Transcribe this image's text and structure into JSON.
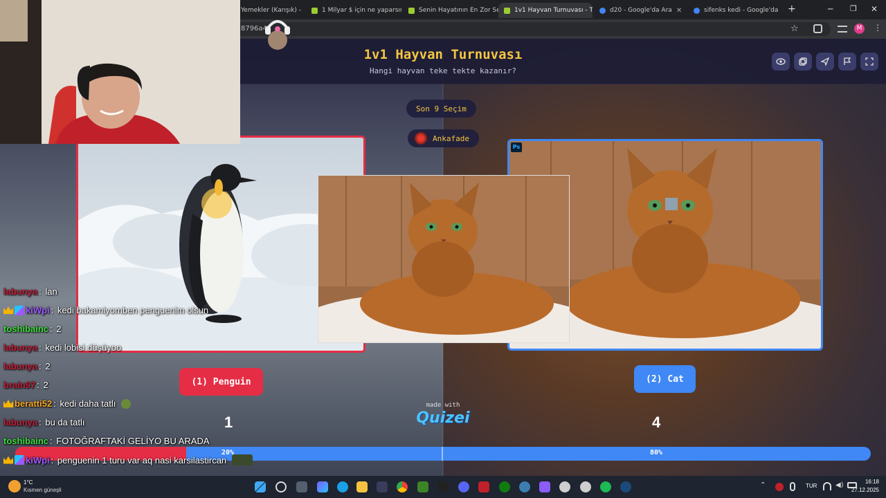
{
  "browser": {
    "tabs": [
      {
        "title": "Yemekler (Karışık) -",
        "color": "#e8a033"
      },
      {
        "title": "1 Milyar $ için ne yaparsın",
        "color": "#9acd32"
      },
      {
        "title": "Senin Hayatının En Zor Se",
        "color": "#9acd32"
      },
      {
        "title": "1v1 Hayvan Turnuvası - T",
        "color": "#9acd32"
      },
      {
        "title": "d20 - Google'da Ara",
        "color": "#4285f4"
      },
      {
        "title": "sifenks kedi - Google'da",
        "color": "#4285f4"
      }
    ],
    "url_fragment": "8796a4",
    "profile_initial": "M"
  },
  "quiz": {
    "title": "1v1 Hayvan Turnuvası",
    "subtitle": "Hangi hayvan teke tekte kazanır?",
    "round_label": "Son 9 Seçim",
    "author": "Ankafade",
    "header_icons": [
      "eye-icon",
      "copy-icon",
      "send-icon",
      "flag-icon",
      "fullscreen-icon"
    ],
    "left": {
      "button": "(1) Penguin",
      "score": "1",
      "percent": "20%",
      "color": "#e52d45",
      "fraction": 0.2
    },
    "right": {
      "button": "(2) Cat",
      "score": "4",
      "percent": "80%",
      "color": "#3f88f5"
    },
    "made_with": "made with",
    "brand": "Quizei",
    "ps_badge": "Ps"
  },
  "chat": [
    {
      "user": "labunya",
      "color": "#c0203a",
      "msg": "lan",
      "badges": []
    },
    {
      "user": "kiWpi",
      "color": "#9b59ff",
      "msg": "kedi bakamiyomben penguenim olsun",
      "badges": [
        "crown",
        "square"
      ]
    },
    {
      "user": "toshibainc",
      "color": "#3ddc3d",
      "msg": "2",
      "badges": []
    },
    {
      "user": "labunya",
      "color": "#c0203a",
      "msg": "kedi lobisi düşüyoo",
      "badges": []
    },
    {
      "user": "labunya",
      "color": "#c0203a",
      "msg": "2",
      "badges": []
    },
    {
      "user": "brain97",
      "color": "#c0203a",
      "msg": "2",
      "badges": []
    },
    {
      "user": "beratti52",
      "color": "#f5a623",
      "msg": "kedi daha tatlı",
      "badges": [
        "crown"
      ]
    },
    {
      "user": "labunya",
      "color": "#c0203a",
      "msg": "bu da tatlı",
      "badges": []
    },
    {
      "user": "toshibainc",
      "color": "#3ddc3d",
      "msg": "FOTOĞRAFTAKİ GELİYO BU ARADA",
      "badges": []
    },
    {
      "user": "kiWpi",
      "color": "#9b59ff",
      "msg": "penguenin 1 turu var aq nasi karsilastircan",
      "badges": [
        "crown",
        "square"
      ]
    }
  ],
  "taskbar": {
    "weather_temp": "1°C",
    "weather_desc": "Kısmen güneşli",
    "language": "TUR",
    "time": "16:18",
    "date": "27.12.2025"
  }
}
